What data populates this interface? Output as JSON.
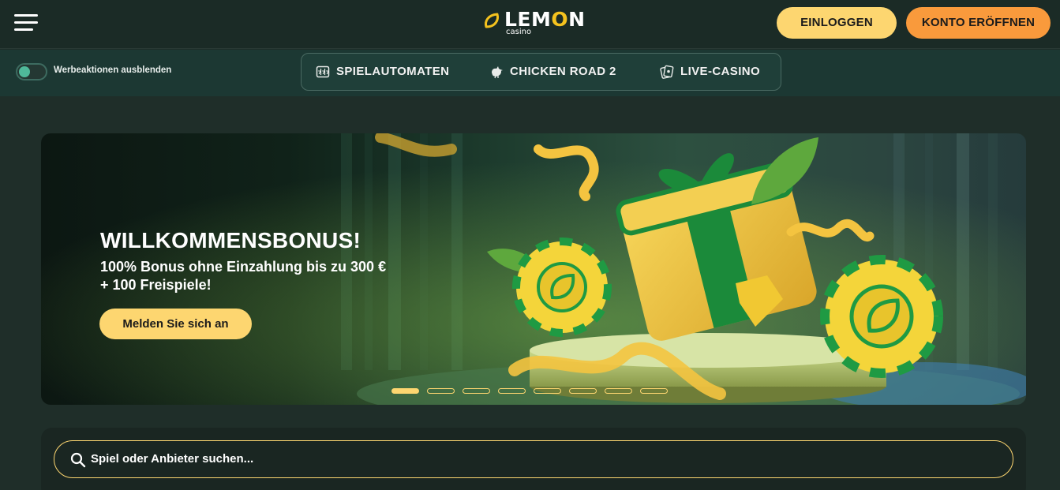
{
  "header": {
    "logo_word": "LEMON",
    "logo_sub": "casino",
    "login_label": "EINLOGGEN",
    "register_label": "KONTO ERÖFFNEN"
  },
  "subnav": {
    "toggle_label": "Werbeaktionen ausblenden",
    "toggle_on": false,
    "items": [
      {
        "label": "SPIELAUTOMATEN",
        "icon": "slot-machine-icon"
      },
      {
        "label": "CHICKEN ROAD 2",
        "icon": "chicken-icon"
      },
      {
        "label": "LIVE-CASINO",
        "icon": "cards-icon"
      }
    ]
  },
  "hero": {
    "title": "WILLKOMMENSBONUS!",
    "subtitle": "100% Bonus ohne Einzahlung bis zu 300 € + 100 Freispiele!",
    "cta_label": "Melden Sie sich an",
    "slides_total": 8,
    "active_slide": 1
  },
  "search": {
    "placeholder": "Spiel oder Anbieter suchen..."
  },
  "colors": {
    "accent_yellow": "#fdd670",
    "accent_orange": "#f99a3c",
    "brand_green": "#1c3833",
    "background": "#1f2e29"
  }
}
